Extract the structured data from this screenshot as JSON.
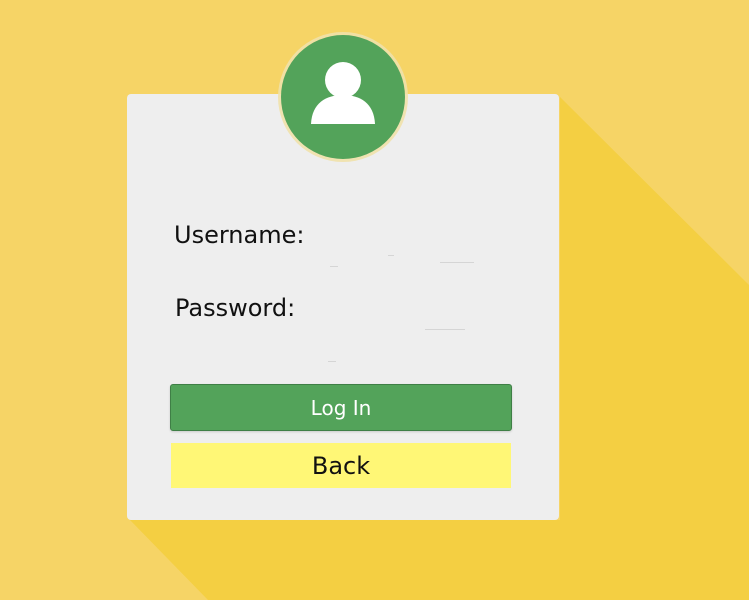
{
  "form": {
    "username_label": "Username:",
    "username_value": "",
    "password_label": "Password:",
    "password_value": "",
    "login_label": "Log In",
    "back_label": "Back"
  },
  "icons": {
    "avatar": "user-silhouette-icon"
  },
  "colors": {
    "background": "#f6d466",
    "shadow": "#f4cf42",
    "card": "#eeeeee",
    "accent_green": "#53a35a",
    "back_button": "#fff776"
  }
}
